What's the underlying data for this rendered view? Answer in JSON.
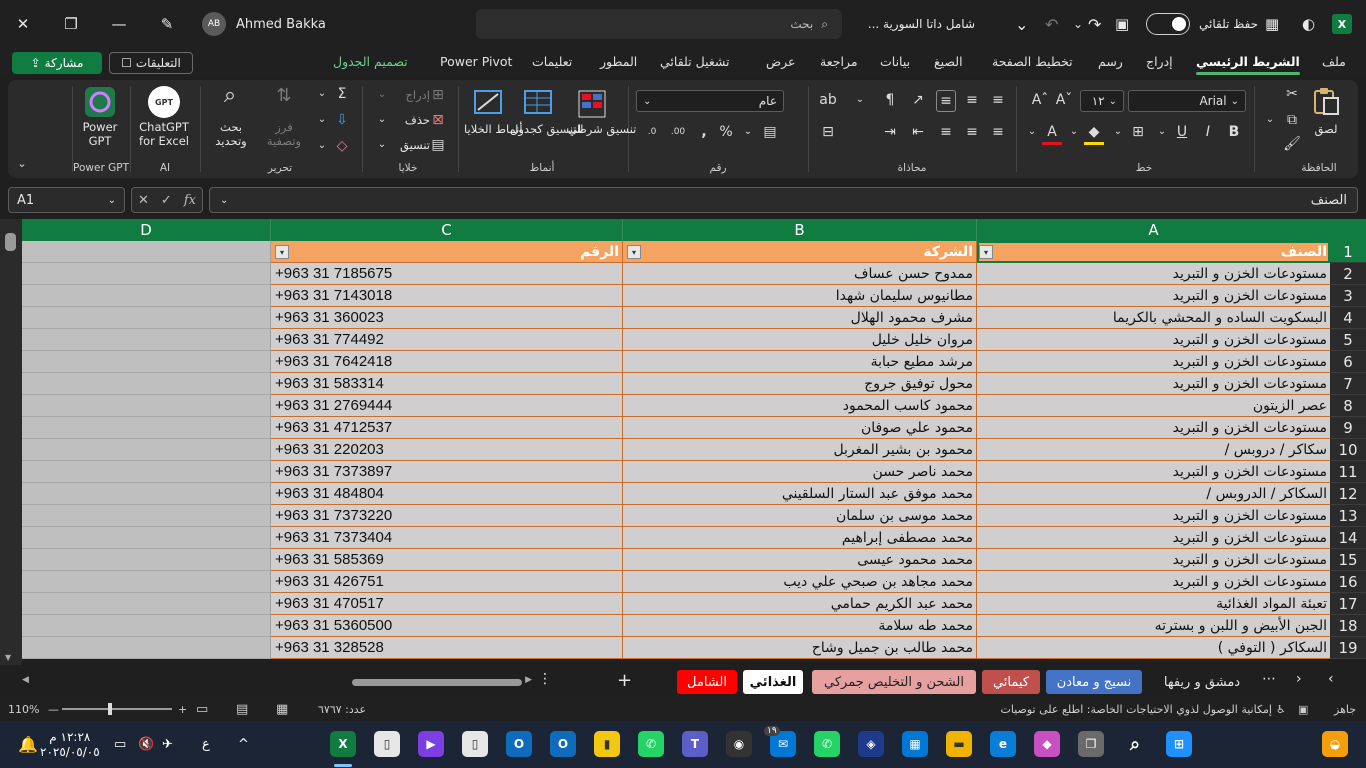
{
  "titlebar": {
    "user_name": "Ahmed Bakka",
    "user_initials": "AB",
    "search_placeholder": "بحث",
    "file_name": "شامل داتا السورية ...",
    "autosave_label": "حفظ تلقائي"
  },
  "ribbon_tabs": [
    "ملف",
    "الشريط الرئيسي",
    "إدراج",
    "رسم",
    "تخطيط الصفحة",
    "الصيغ",
    "بيانات",
    "مراجعة",
    "عرض",
    "تشغيل تلقائي",
    "المطور",
    "تعليمات",
    "Power Pivot",
    "تصميم الجدول"
  ],
  "share_label": "مشاركة",
  "comments_label": "التعليقات",
  "ribbon": {
    "clipboard": {
      "paste": "لصق",
      "group": "الحافظة"
    },
    "font": {
      "name": "Arial",
      "size": "١٢",
      "group": "خط"
    },
    "alignment": {
      "group": "محاذاة"
    },
    "number": {
      "format": "عام",
      "group": "رقم"
    },
    "styles": {
      "conditional": "تنسيق شرطي",
      "table": "التنسيق كجدول",
      "cell": "أنماط الخلايا",
      "group": "أنماط"
    },
    "cells": {
      "insert": "إدراج",
      "delete": "حذف",
      "format": "تنسيق",
      "group": "خلايا"
    },
    "editing": {
      "sort": "فرز وتصفية",
      "find": "بحث وتحديد",
      "group": "تحرير"
    },
    "ai": {
      "chatgpt": "ChatGPT for Excel",
      "group": "AI"
    },
    "powergpt": {
      "label": "Power GPT",
      "group": "Power GPT"
    }
  },
  "formula_bar": {
    "name_box": "A1",
    "formula": "الصنف"
  },
  "columns": [
    "A",
    "B",
    "C",
    "D"
  ],
  "table": {
    "headers": [
      "الصنف",
      "الشركة",
      "الرقم"
    ],
    "rows": [
      [
        "مستودعات الخزن و التبريد",
        "ممدوح حسن عساف",
        "+963 31 7185675"
      ],
      [
        "مستودعات الخزن و التبريد",
        "مطانيوس سليمان شهدا",
        "+963 31 7143018"
      ],
      [
        "البسكويت الساده و المحشي بالكريما",
        "مشرف محمود الهلال",
        "+963 31 360023"
      ],
      [
        "مستودعات الخزن و التبريد",
        "مروان خليل خليل",
        "+963 31 774492"
      ],
      [
        "مستودعات الخزن و التبريد",
        "مرشد مطيع حبابة",
        "+963 31 7642418"
      ],
      [
        "مستودعات الخزن و التبريد",
        "محول توفيق جروج",
        "+963 31 583314"
      ],
      [
        "عصر الزيتون",
        "محمود كاسب المحمود",
        "+963 31 2769444"
      ],
      [
        "مستودعات الخزن و التبريد",
        "محمود علي صوفان",
        "+963 31 4712537"
      ],
      [
        "سكاكر / دروبس /",
        "محمود بن بشير المغربل",
        "+963 31 220203"
      ],
      [
        "مستودعات الخزن و التبريد",
        "محمد ناصر حسن",
        "+963 31 7373897"
      ],
      [
        "السكاكر / الدروبس /",
        "محمد موفق عبد الستار السلقيني",
        "+963 31 484804"
      ],
      [
        "مستودعات الخزن و التبريد",
        "محمد موسى بن سلمان",
        "+963 31 7373220"
      ],
      [
        "مستودعات الخزن و التبريد",
        "محمد مصطفى إبراهيم",
        "+963 31 7373404"
      ],
      [
        "مستودعات الخزن و التبريد",
        "محمد محمود عيسى",
        "+963 31 585369"
      ],
      [
        "مستودعات الخزن و التبريد",
        "محمد مجاهد بن صبحي علي ديب",
        "+963 31 426751"
      ],
      [
        "تعبئة المواد الغذائية",
        "محمد عبد الكريم حمامي",
        "+963 31 470517"
      ],
      [
        "الجبن الأبيض و اللبن و بسترته",
        "محمد طه سلامة",
        "+963 31 5360500"
      ],
      [
        "السكاكر ( التوفي )",
        "محمد طالب بن جميل وشاح",
        "+963 31 328528"
      ]
    ]
  },
  "row_numbers": [
    "1",
    "2",
    "3",
    "4",
    "5",
    "6",
    "7",
    "8",
    "9",
    "10",
    "11",
    "12",
    "13",
    "14",
    "15",
    "16",
    "17",
    "18",
    "19"
  ],
  "sheet_tabs": [
    {
      "label": "دمشق و ريفها",
      "bg": "#1f1f1f",
      "fg": "#e6e6e6"
    },
    {
      "label": "نسيج و معادن",
      "bg": "#4472c4",
      "fg": "#ffffff"
    },
    {
      "label": "كيمائي",
      "bg": "#c0504d",
      "fg": "#ffffff"
    },
    {
      "label": "الشحن و التخليص جمركي",
      "bg": "#e6a0a0",
      "fg": "#222222"
    },
    {
      "label": "الغذائي",
      "bg": "#ffffff",
      "fg": "#111111"
    },
    {
      "label": "الشامل",
      "bg": "#ff0000",
      "fg": "#ffffff"
    }
  ],
  "status": {
    "ready": "جاهز",
    "accessibility": "إمكانية الوصول لذوي الاحتياجات الخاصة: اطلع على توصيات",
    "count": "عدد: ٦٧٦٧",
    "zoom": "110%"
  },
  "taskbar": {
    "time": "١٢:٢٨ م",
    "date": "٢٠٢٥/٠٥/٠٥",
    "lang": "ع",
    "badge": "١٩"
  },
  "colors": {
    "accent": "#107c41",
    "header_fill": "#f4a460",
    "row_fill": "#d0cece",
    "border": "#c96d2c"
  }
}
